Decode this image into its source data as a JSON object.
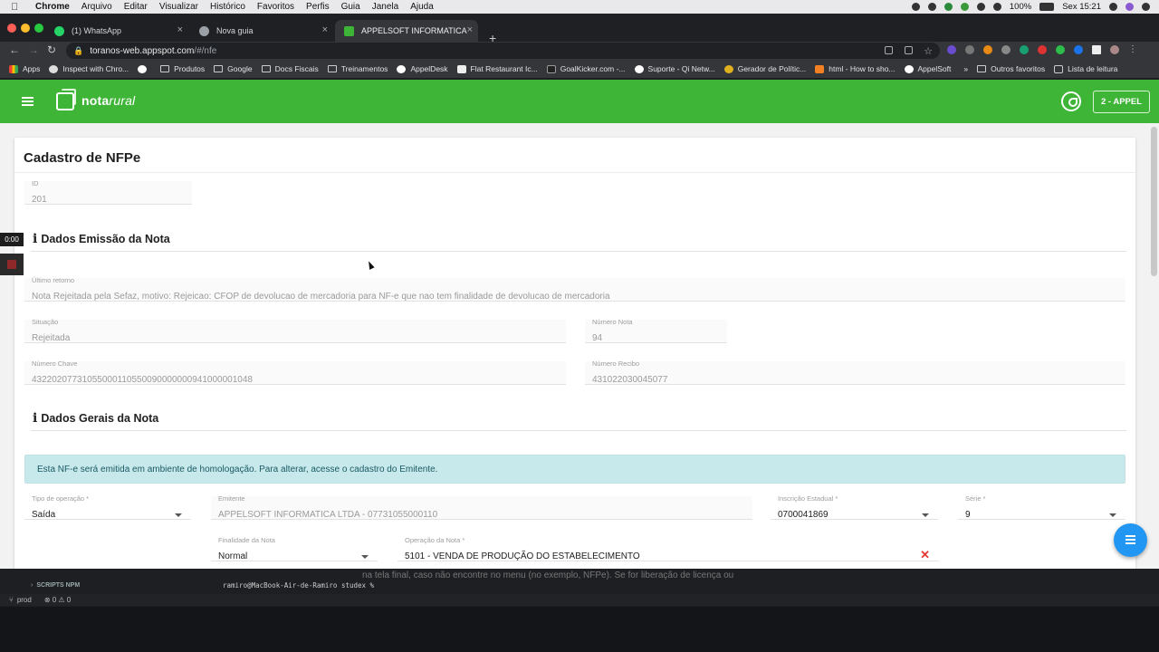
{
  "macos": {
    "menu": [
      "Chrome",
      "Arquivo",
      "Editar",
      "Visualizar",
      "Histórico",
      "Favoritos",
      "Perfis",
      "Guia",
      "Janela",
      "Ajuda"
    ],
    "battery": "100%",
    "clock": "Sex 15:21"
  },
  "browser": {
    "tabs": [
      {
        "title": "(1) WhatsApp",
        "color": "#25d366"
      },
      {
        "title": "Nova guia",
        "color": "#9aa0a6"
      },
      {
        "title": "APPELSOFT INFORMATICA LTD",
        "color": "#3fb538"
      }
    ],
    "url_host": "toranos-web.appspot.com",
    "url_path": "/#/nfe",
    "bookmarks": [
      {
        "label": "Apps",
        "icon": "apps-icon"
      },
      {
        "label": "Inspect with Chro...",
        "icon": "globe-icon"
      },
      {
        "label": "",
        "icon": "globe-icon"
      },
      {
        "label": "Produtos",
        "icon": "folder-icon"
      },
      {
        "label": "Google",
        "icon": "folder-icon"
      },
      {
        "label": "Docs Fiscais",
        "icon": "folder-icon"
      },
      {
        "label": "Treinamentos",
        "icon": "folder-icon"
      },
      {
        "label": "AppelDesk",
        "icon": "globe-icon"
      },
      {
        "label": "Flat Restaurant Ic...",
        "icon": "globe-icon"
      },
      {
        "label": "GoalKicker.com -...",
        "icon": "globe-icon"
      },
      {
        "label": "Suporte - Qi Netw...",
        "icon": "globe-icon"
      },
      {
        "label": "Gerador de Polític...",
        "icon": "globe-icon"
      },
      {
        "label": "html - How to sho...",
        "icon": "globe-icon"
      },
      {
        "label": "AppelSoft",
        "icon": "globe-icon"
      }
    ],
    "bookmarks_more": "»",
    "other_bookmarks": "Outros favoritos",
    "reading_list": "Lista de leitura"
  },
  "app": {
    "brand_bold": "nota",
    "brand_italic": "rural",
    "user_button": "2 - APPEL",
    "accent": "#3fb538"
  },
  "form": {
    "title": "Cadastro de NFPe",
    "id": {
      "label": "ID",
      "value": "201"
    },
    "section_emissao": "Dados Emissão da Nota",
    "ultimo_retorno": {
      "label": "Último retorno",
      "value": "Nota Rejeitada pela Sefaz, motivo: Rejeicao: CFOP de devolucao de mercadoria para NF-e que nao tem finalidade de devolucao de mercadoria"
    },
    "situacao": {
      "label": "Situação",
      "value": "Rejeitada"
    },
    "numero_nota": {
      "label": "Número Nota",
      "value": "94"
    },
    "numero_chave": {
      "label": "Número Chave",
      "value": "43220207731055000110550090000000941000001048"
    },
    "numero_recibo": {
      "label": "Número Recibo",
      "value": "431022030045077"
    },
    "section_gerais": "Dados Gerais da Nota",
    "alert": "Esta NF-e será emitida em ambiente de homologação. Para alterar, acesse o cadastro do Emitente.",
    "tipo_operacao": {
      "label": "Tipo de operação *",
      "value": "Saída"
    },
    "emitente": {
      "label": "Emitente",
      "value": "APPELSOFT INFORMATICA LTDA - 07731055000110"
    },
    "inscricao_estadual": {
      "label": "Inscrição Estadual *",
      "value": "0700041869"
    },
    "serie": {
      "label": "Série *",
      "value": "9"
    },
    "finalidade": {
      "label": "Finalidade da Nota",
      "value": "Normal"
    },
    "operacao": {
      "label": "Operação da Nota *",
      "value": "5101 - VENDA DE PRODUÇÃO DO ESTABELECIMENTO"
    }
  },
  "recorder": {
    "time": "0:00"
  },
  "terminal": {
    "section": "SCRIPTS NPM",
    "prompt": "ramiro@MacBook-Air-de-Ramiro studex % ",
    "ghost_line1": "na tela final, caso não encontre no menu (no exemplo, NFPe). Se for liberação de licença ou",
    "branch": "prod",
    "problems": "⊗ 0 ⚠ 0"
  }
}
